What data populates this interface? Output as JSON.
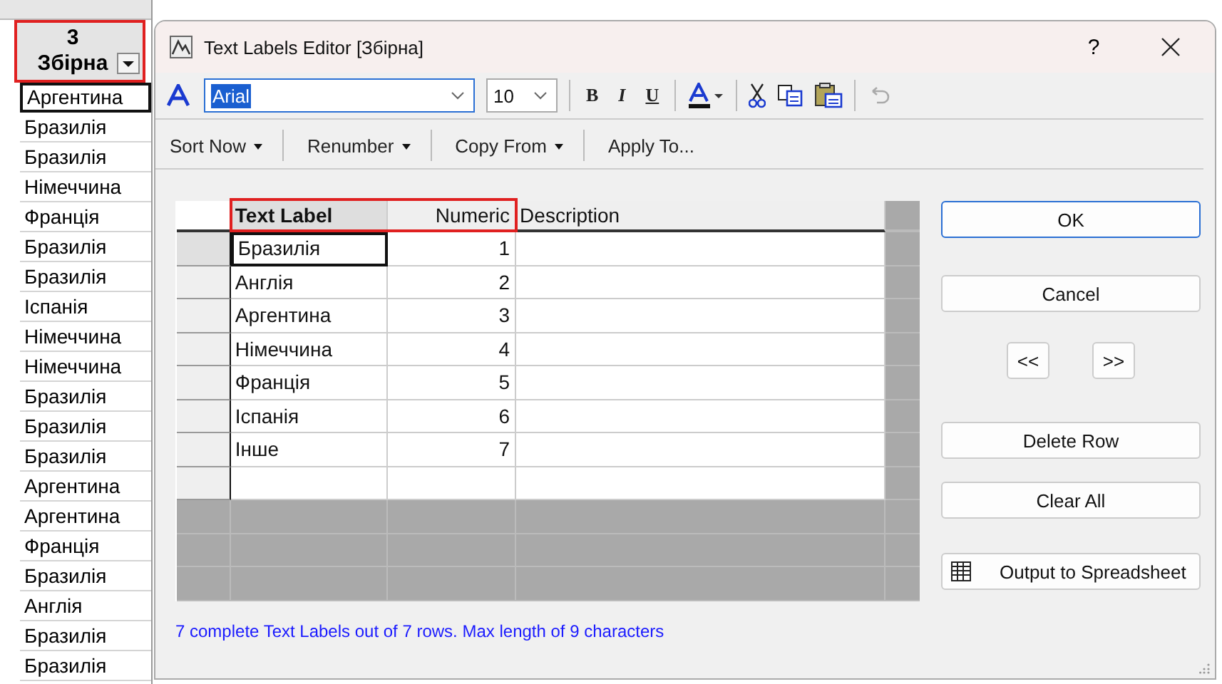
{
  "sheet_column": {
    "header_number": "3",
    "header_name": "Збірна",
    "cells": [
      {
        "value": "Аргентина",
        "selected": true
      },
      {
        "value": "Бразилія",
        "selected": false
      },
      {
        "value": "Бразилія",
        "selected": false
      },
      {
        "value": "Німеччина",
        "selected": false
      },
      {
        "value": "Франція",
        "selected": false
      },
      {
        "value": "Бразилія",
        "selected": false
      },
      {
        "value": "Бразилія",
        "selected": false
      },
      {
        "value": "Іспанія",
        "selected": false
      },
      {
        "value": "Німеччина",
        "selected": false
      },
      {
        "value": "Німеччина",
        "selected": false
      },
      {
        "value": "Бразилія",
        "selected": false
      },
      {
        "value": "Бразилія",
        "selected": false
      },
      {
        "value": "Бразилія",
        "selected": false
      },
      {
        "value": "Аргентина",
        "selected": false
      },
      {
        "value": "Аргентина",
        "selected": false
      },
      {
        "value": "Франція",
        "selected": false
      },
      {
        "value": "Бразилія",
        "selected": false
      },
      {
        "value": "Англія",
        "selected": false
      },
      {
        "value": "Бразилія",
        "selected": false
      },
      {
        "value": "Бразилія",
        "selected": false
      }
    ]
  },
  "window": {
    "title": "Text Labels Editor [Збірна]",
    "help": "?"
  },
  "toolbar": {
    "font": {
      "value": "Arial",
      "text_selected": true
    },
    "size": {
      "value": "10"
    },
    "format_buttons": [
      "B",
      "I",
      "U"
    ]
  },
  "menu": [
    {
      "label": "Sort Now",
      "dropdown": true
    },
    {
      "label": "Renumber",
      "dropdown": true
    },
    {
      "label": "Copy From",
      "dropdown": true
    },
    {
      "label": "Apply To...",
      "dropdown": false
    }
  ],
  "table": {
    "columns": [
      "Text Label",
      "Numeric",
      "Description"
    ],
    "rows": [
      {
        "label": "Бразилія",
        "numeric": "1",
        "selected": true
      },
      {
        "label": "Англія",
        "numeric": "2",
        "selected": false
      },
      {
        "label": "Аргентина",
        "numeric": "3",
        "selected": false
      },
      {
        "label": "Німеччина",
        "numeric": "4",
        "selected": false
      },
      {
        "label": "Франція",
        "numeric": "5",
        "selected": false
      },
      {
        "label": "Іспанія",
        "numeric": "6",
        "selected": false
      },
      {
        "label": "Інше",
        "numeric": "7",
        "selected": false
      }
    ]
  },
  "buttons": {
    "ok": "OK",
    "cancel": "Cancel",
    "prev": "<<",
    "next": ">>",
    "delete_row": "Delete Row",
    "clear_all": "Clear All",
    "output": "Output to Spreadsheet"
  },
  "status": "7 complete Text Labels out of 7 rows. Max length of 9 characters"
}
